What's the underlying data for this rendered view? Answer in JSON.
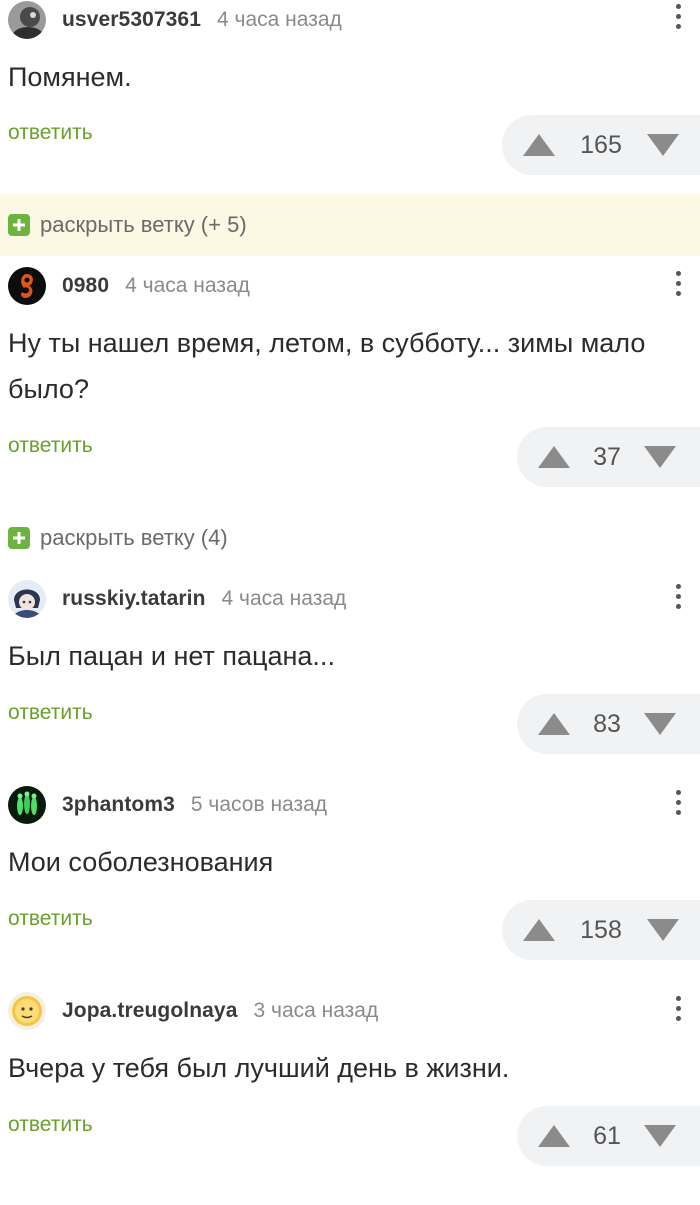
{
  "comments": [
    {
      "author": "usver5307361",
      "time": "4 часа назад",
      "text": "Помянем.",
      "reply_label": "ответить",
      "votes": "165"
    },
    {
      "author": "0980",
      "time": "4 часа назад",
      "text": "Ну ты нашел время, летом, в субботу... зимы мало было?",
      "reply_label": "ответить",
      "votes": "37"
    },
    {
      "author": "russkiy.tatarin",
      "time": "4 часа назад",
      "text": "Был пацан и нет пацана...",
      "reply_label": "ответить",
      "votes": "83"
    },
    {
      "author": "3phantom3",
      "time": "5 часов назад",
      "text": "Мои соболезнования",
      "reply_label": "ответить",
      "votes": "158"
    },
    {
      "author": "Jopa.treugolnaya",
      "time": "3 часа назад",
      "text": "Вчера у тебя был лучший день в жизни.",
      "reply_label": "ответить",
      "votes": "61"
    }
  ],
  "branches": [
    {
      "label": "раскрыть ветку (+ 5)"
    },
    {
      "label": "раскрыть ветку (4)"
    }
  ],
  "colors": {
    "reply": "#67a12b",
    "branch_highlight": "#fdf8e4",
    "vote_bg": "#f1f2f4",
    "plus_badge": "#6db33f"
  },
  "icons": [
    "user-avatar",
    "vote-up-arrow",
    "vote-down-arrow",
    "more-options-kebab",
    "expand-plus"
  ]
}
